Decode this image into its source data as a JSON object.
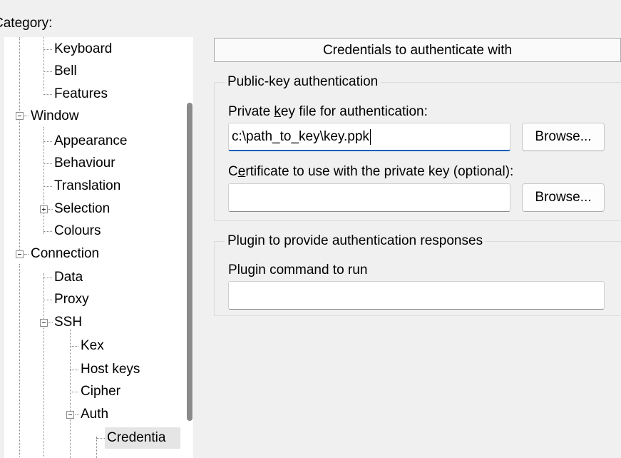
{
  "category": {
    "label_pre": "Cate",
    "label_key": "g",
    "label_post": "ory:"
  },
  "tree": {
    "items": [
      {
        "label": "Keyboard"
      },
      {
        "label": "Bell"
      },
      {
        "label": "Features"
      },
      {
        "label": "Window"
      },
      {
        "label": "Appearance"
      },
      {
        "label": "Behaviour"
      },
      {
        "label": "Translation"
      },
      {
        "label": "Selection"
      },
      {
        "label": "Colours"
      },
      {
        "label": "Connection"
      },
      {
        "label": "Data"
      },
      {
        "label": "Proxy"
      },
      {
        "label": "SSH"
      },
      {
        "label": "Kex"
      },
      {
        "label": "Host keys"
      },
      {
        "label": "Cipher"
      },
      {
        "label": "Auth"
      },
      {
        "label": "Credentia"
      }
    ]
  },
  "panel": {
    "header": "Credentials to authenticate with",
    "pubkey_group": {
      "title": "Public-key authentication",
      "private_key_label_pre": "Private ",
      "private_key_label_key": "k",
      "private_key_label_post": "ey file for authentication:",
      "private_key_value": "c:\\path_to_key\\key.ppk",
      "browse1": "Browse...",
      "cert_label_pre": "C",
      "cert_label_key": "e",
      "cert_label_post": "rtificate to use with the private key (optional):",
      "cert_value": "",
      "browse2": "Browse..."
    },
    "plugin_group": {
      "title": "Plugin to provide authentication responses",
      "command_label": "Plugin command to run",
      "command_value": ""
    }
  }
}
